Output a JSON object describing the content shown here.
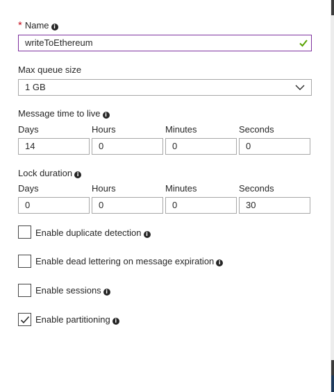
{
  "name_field": {
    "label": "Name",
    "required_marker": "*",
    "value": "writeToEthereum"
  },
  "max_queue_size": {
    "label": "Max queue size",
    "selected": "1 GB"
  },
  "message_ttl": {
    "label": "Message time to live",
    "columns": [
      {
        "label": "Days",
        "value": "14"
      },
      {
        "label": "Hours",
        "value": "0"
      },
      {
        "label": "Minutes",
        "value": "0"
      },
      {
        "label": "Seconds",
        "value": "0"
      }
    ]
  },
  "lock_duration": {
    "label": "Lock duration",
    "columns": [
      {
        "label": "Days",
        "value": "0"
      },
      {
        "label": "Hours",
        "value": "0"
      },
      {
        "label": "Minutes",
        "value": "0"
      },
      {
        "label": "Seconds",
        "value": "30"
      }
    ]
  },
  "options": [
    {
      "label": "Enable duplicate detection",
      "checked": false
    },
    {
      "label": "Enable dead lettering on message expiration",
      "checked": false
    },
    {
      "label": "Enable sessions",
      "checked": false
    },
    {
      "label": "Enable partitioning",
      "checked": true
    }
  ],
  "info_glyph": "i",
  "colors": {
    "focus_border": "#7c2e9c",
    "valid_check": "#57a300",
    "required": "#c50f1f"
  }
}
